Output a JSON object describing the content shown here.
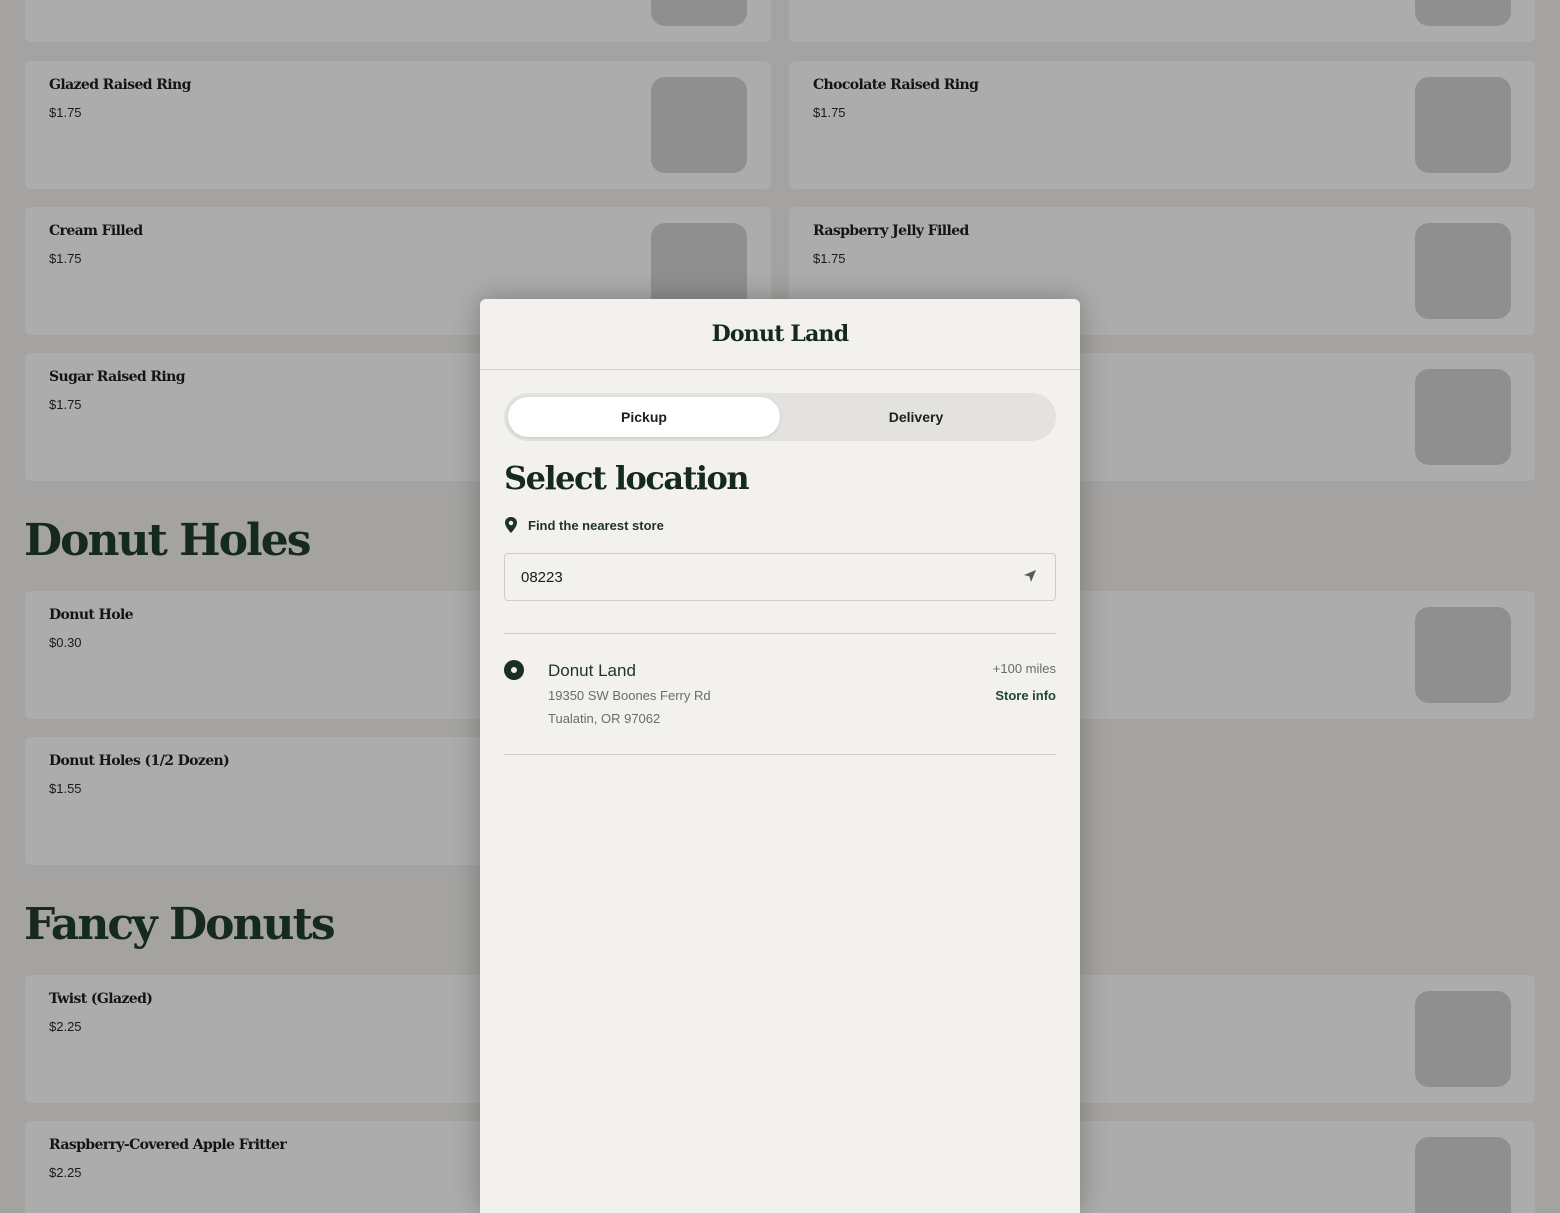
{
  "menu": {
    "items": [
      {
        "name": "Glazed Raised Ring",
        "price": "$1.75"
      },
      {
        "name": "Chocolate Raised Ring",
        "price": "$1.75"
      },
      {
        "name": "Cream Filled",
        "price": "$1.75"
      },
      {
        "name": "Raspberry Jelly Filled",
        "price": "$1.75"
      },
      {
        "name": "Sugar Raised Ring",
        "price": "$1.75"
      }
    ],
    "sections": [
      {
        "title": "Donut Holes",
        "items": [
          {
            "name": "Donut Hole",
            "price": "$0.30"
          },
          {
            "name": "Donut Holes (1/2 Dozen)",
            "price": "$1.55"
          }
        ]
      },
      {
        "title": "Fancy Donuts",
        "items": [
          {
            "name": "Twist (Glazed)",
            "price": "$2.25"
          },
          {
            "name": "Raspberry-Covered Apple Fritter",
            "price": "$2.25"
          }
        ]
      }
    ]
  },
  "modal": {
    "title": "Donut Land",
    "tabs": {
      "pickup": "Pickup",
      "delivery": "Delivery",
      "active": "pickup"
    },
    "heading": "Select location",
    "find_nearest": "Find the nearest store",
    "search": {
      "value": "08223"
    },
    "stores": [
      {
        "name": "Donut Land",
        "address_line1": "19350 SW Boones Ferry Rd",
        "address_line2": "Tualatin, OR 97062",
        "distance": "+100 miles",
        "info_label": "Store info",
        "selected": true
      }
    ]
  },
  "colors": {
    "brand_green": "#16291f",
    "overlay": "#a4a3a1",
    "modal_bg": "#f2f1ed"
  },
  "icons": [
    "location-pin-icon",
    "locate-arrow-icon"
  ]
}
